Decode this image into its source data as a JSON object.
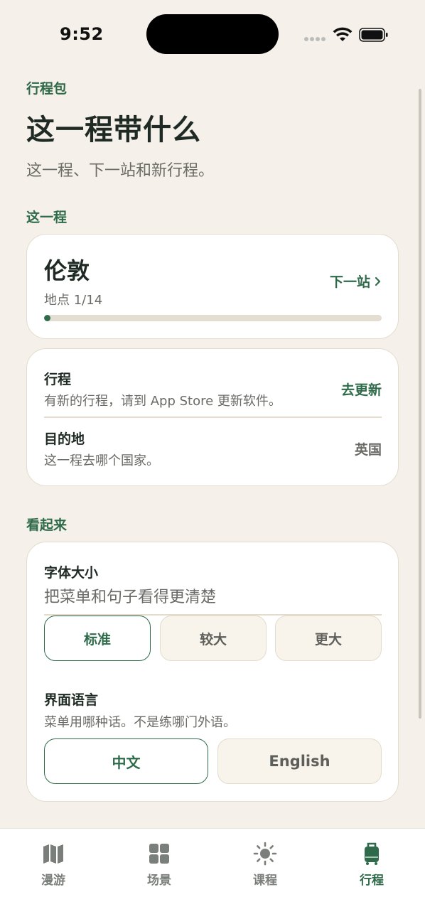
{
  "status_bar": {
    "time": "9:52"
  },
  "header": {
    "eyebrow": "行程包",
    "title": "这一程带什么",
    "subtitle": "这一程、下一站和新行程。"
  },
  "trip_section": {
    "label": "这一程",
    "city": "伦敦",
    "progress_text": "地点 1/14",
    "progress_fraction": 0.0714,
    "next_stop_label": "下一站",
    "next_stop_icon": "chevron-right-icon"
  },
  "settings": {
    "itinerary": {
      "title": "行程",
      "description": "有新的行程，请到 App Store 更新软件。",
      "action": "去更新"
    },
    "destination": {
      "title": "目的地",
      "description": "这一程去哪个国家。",
      "value": "英国"
    }
  },
  "appearance_section": {
    "label": "看起来",
    "font_size": {
      "title": "字体大小",
      "description": "把菜单和句子看得更清楚",
      "options": [
        "标准",
        "较大",
        "更大"
      ],
      "selected": "标准"
    },
    "language": {
      "title": "界面语言",
      "description": "菜单用哪种话。不是练哪门外语。",
      "options": [
        "中文",
        "English"
      ],
      "selected": "中文"
    }
  },
  "tab_bar": {
    "tabs": [
      {
        "label": "漫游",
        "icon": "map-icon"
      },
      {
        "label": "场景",
        "icon": "grid-icon"
      },
      {
        "label": "课程",
        "icon": "sun-icon"
      },
      {
        "label": "行程",
        "icon": "luggage-icon"
      }
    ],
    "active": "行程"
  },
  "colors": {
    "accent": "#2f6b4a",
    "background": "#f5f1ea",
    "card": "#ffffff",
    "border": "#e3dccd",
    "muted_text": "#6a6a66"
  }
}
